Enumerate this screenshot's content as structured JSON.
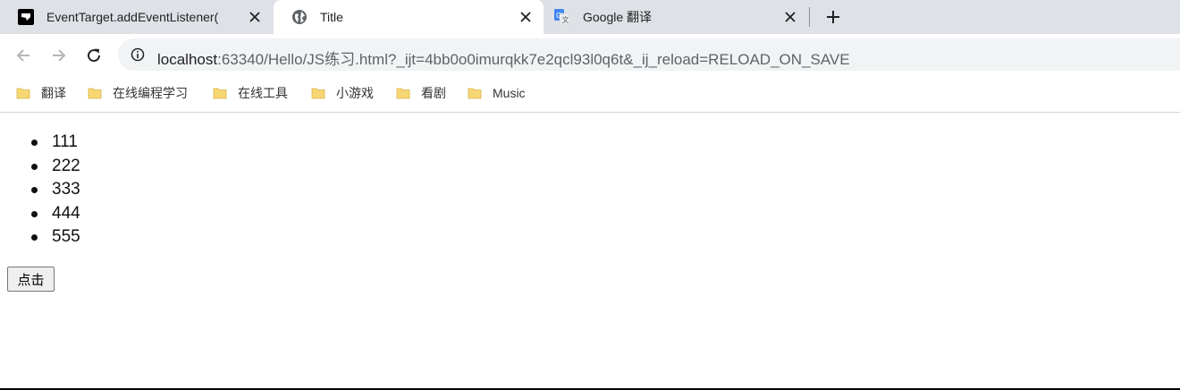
{
  "browser": {
    "tabs": [
      {
        "title": "EventTarget.addEventListener(",
        "favicon": "mdn-icon",
        "active": false
      },
      {
        "title": "Title",
        "favicon": "globe-icon",
        "active": true
      },
      {
        "title": "Google 翻译",
        "favicon": "google-translate-icon",
        "active": false
      }
    ],
    "address": {
      "host": "localhost",
      "rest": ":63340/Hello/JS练习.html?_ijt=4bb0o0imurqkk7e2qcl93l0q6t&_ij_reload=RELOAD_ON_SAVE"
    },
    "bookmarks": [
      {
        "label": "翻译",
        "icon": "folder-icon"
      },
      {
        "label": "在线编程学习",
        "icon": "folder-icon"
      },
      {
        "label": "在线工具",
        "icon": "folder-icon"
      },
      {
        "label": "小游戏",
        "icon": "folder-icon"
      },
      {
        "label": "看剧",
        "icon": "folder-icon"
      },
      {
        "label": "Music",
        "icon": "folder-icon"
      }
    ]
  },
  "page": {
    "list_items": [
      "111",
      "222",
      "333",
      "444",
      "555"
    ],
    "button_label": "点击"
  },
  "colors": {
    "tabstrip": "#dee1e6",
    "omnibox": "#f1f3f4",
    "folder": "#f7d774"
  }
}
